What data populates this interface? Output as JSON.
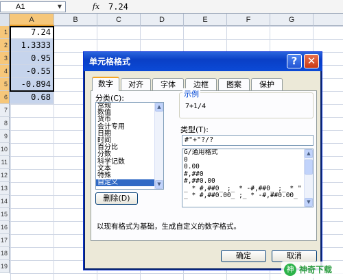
{
  "formula_bar": {
    "cell_ref": "A1",
    "fx": "fx",
    "formula": "7.24"
  },
  "columns": [
    "A",
    "B",
    "C",
    "D",
    "E",
    "F",
    "G"
  ],
  "rows": [
    "1",
    "2",
    "3",
    "4",
    "5",
    "6",
    "7",
    "8",
    "9",
    "10",
    "11",
    "12",
    "13",
    "14",
    "15",
    "16",
    "17",
    "18",
    "19"
  ],
  "cells": [
    "7.24",
    "1.3333",
    "0.95",
    "-0.55",
    "-0.894",
    "0.68"
  ],
  "dialog": {
    "title": "单元格格式",
    "help": "?",
    "close": "✕",
    "tabs": [
      "数字",
      "对齐",
      "字体",
      "边框",
      "图案",
      "保护"
    ],
    "category_label": "分类(C):",
    "categories": [
      "常规",
      "数值",
      "货币",
      "会计专用",
      "日期",
      "时间",
      "百分比",
      "分数",
      "科学记数",
      "文本",
      "特殊",
      "自定义"
    ],
    "selected_category": "自定义",
    "sample_title": "示例",
    "sample_value": "7+1/4",
    "type_label": "类型(T):",
    "type_value": "#\"+\"?/?",
    "formats": [
      "G/通用格式",
      "0",
      "0.00",
      "#,##0",
      "#,##0.00",
      "_ * #,##0_ ;_ * -#,##0_ ;_ * \"",
      "_ * #,##0.00_ ;_ * -#,##0.00_"
    ],
    "delete_button": "删除(D)",
    "description": "以现有格式为基础，生成自定义的数字格式。",
    "ok_button": "确定",
    "cancel_button": "取消"
  },
  "watermark": {
    "logo": "神",
    "text": "神奇下载"
  },
  "colors": {
    "title_bar": "#0a3fc6",
    "selection": "#316ac5",
    "accent": "#f6c77a"
  }
}
